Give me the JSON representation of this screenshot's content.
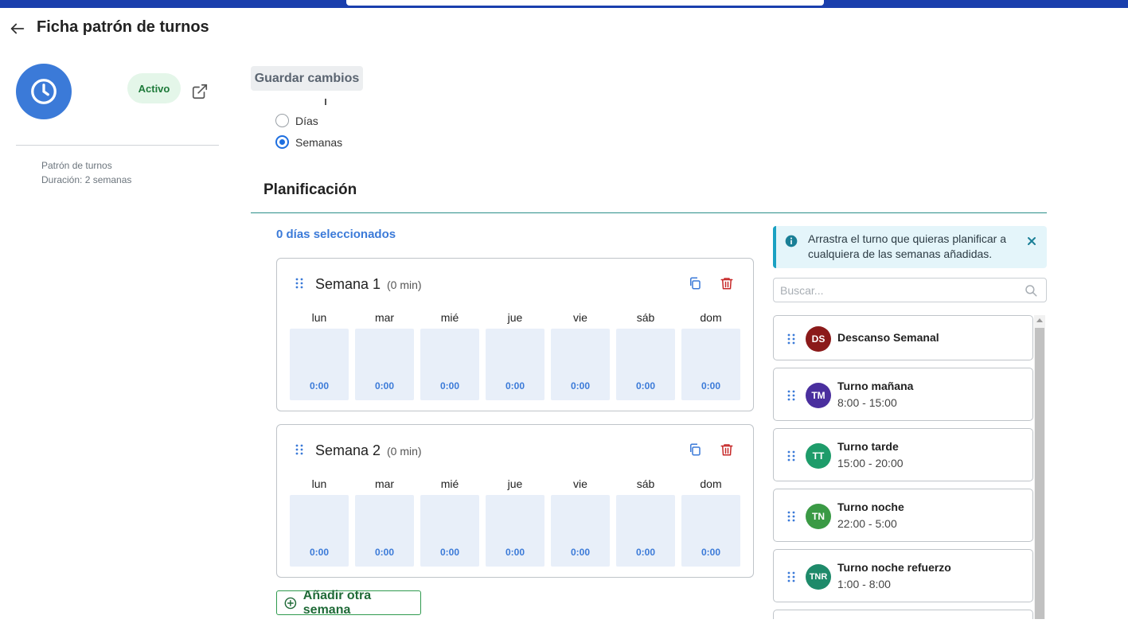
{
  "header": {
    "title": "Ficha patrón de turnos"
  },
  "profile": {
    "status": "Activo",
    "meta_type": "Patrón de turnos",
    "meta_duration": "Duración: 2 semanas"
  },
  "toolbar": {
    "save_label": "Guardar cambios"
  },
  "duration_unit": {
    "options": [
      {
        "label": "Días",
        "checked": false
      },
      {
        "label": "Semanas",
        "checked": true
      }
    ]
  },
  "planning": {
    "title": "Planificación",
    "selected_count": "0 días seleccionados",
    "add_week_label": "Añadir otra semana",
    "day_labels": [
      "lun",
      "mar",
      "mié",
      "jue",
      "vie",
      "sáb",
      "dom"
    ],
    "weeks": [
      {
        "title": "Semana 1",
        "total": "(0 min)",
        "days": [
          "0:00",
          "0:00",
          "0:00",
          "0:00",
          "0:00",
          "0:00",
          "0:00"
        ]
      },
      {
        "title": "Semana 2",
        "total": "(0 min)",
        "days": [
          "0:00",
          "0:00",
          "0:00",
          "0:00",
          "0:00",
          "0:00",
          "0:00"
        ]
      }
    ]
  },
  "shifts_panel": {
    "info_text": "Arrastra el turno que quieras planificar a cualquiera de las semanas añadidas.",
    "search_placeholder": "Buscar...",
    "shifts": [
      {
        "abbr": "DS",
        "name": "Descanso Semanal",
        "time": "",
        "color": "#8b1a1a"
      },
      {
        "abbr": "TM",
        "name": "Turno mañana",
        "time": "8:00 - 15:00",
        "color": "#4a2f9e"
      },
      {
        "abbr": "TT",
        "name": "Turno tarde",
        "time": "15:00 - 20:00",
        "color": "#1e9c6a"
      },
      {
        "abbr": "TN",
        "name": "Turno noche",
        "time": "22:00 - 5:00",
        "color": "#3a9a45"
      },
      {
        "abbr": "TNR",
        "name": "Turno noche refuerzo",
        "time": "1:00 - 8:00",
        "color": "#1e8a6a"
      }
    ]
  },
  "colors": {
    "brand_bar": "#1a3fad",
    "accent_blue": "#3b7ad8",
    "active_green": "#1e7a3a",
    "divider_teal": "#2b8f8a",
    "delete_red": "#c62828"
  }
}
